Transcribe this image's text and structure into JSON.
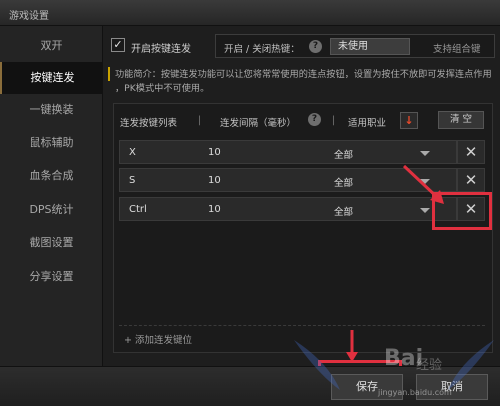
{
  "window": {
    "title": "游戏设置"
  },
  "sidebar": {
    "items": [
      {
        "label": "双开"
      },
      {
        "label": "按键连发"
      },
      {
        "label": "一键换装"
      },
      {
        "label": "鼠标辅助"
      },
      {
        "label": "血条合成"
      },
      {
        "label": "DPS统计"
      },
      {
        "label": "截图设置"
      },
      {
        "label": "分享设置"
      }
    ],
    "active_index": 1
  },
  "settings": {
    "enable_label": "开启按键连发",
    "enable_checked": true,
    "hotkey_label": "开启 / 关闭热键：",
    "hotkey_value": "未使用",
    "combo_label": "支持组合键",
    "help_glyph": "?",
    "notice_line1": "功能简介：按键连发功能可以让您将常常使用的连点按钮，设置为按住不放即可发挥连点作用",
    "notice_line2": "，PK模式中不可使用。"
  },
  "table": {
    "col_key": "连发按键列表",
    "col_interval": "连发间隔（毫秒）",
    "col_job": "适用职业",
    "separator": "|",
    "job_sort_glyph": "↓",
    "clear_label": "清 空",
    "rows": [
      {
        "key": "X",
        "interval": "10",
        "job": "全部"
      },
      {
        "key": "S",
        "interval": "10",
        "job": "全部"
      },
      {
        "key": "Ctrl",
        "interval": "10",
        "job": "全部"
      }
    ],
    "delete_glyph": "✕",
    "add_label": "+ 添加连发键位"
  },
  "footer": {
    "save_label": "保存",
    "cancel_label": "取消"
  },
  "watermark": {
    "logo": "Bai",
    "text": "经验",
    "url": "jingyan.baidu.com"
  },
  "colors": {
    "highlight": "#e0303f",
    "accent": "#c9a200",
    "sort_icon": "#e84a2b"
  }
}
